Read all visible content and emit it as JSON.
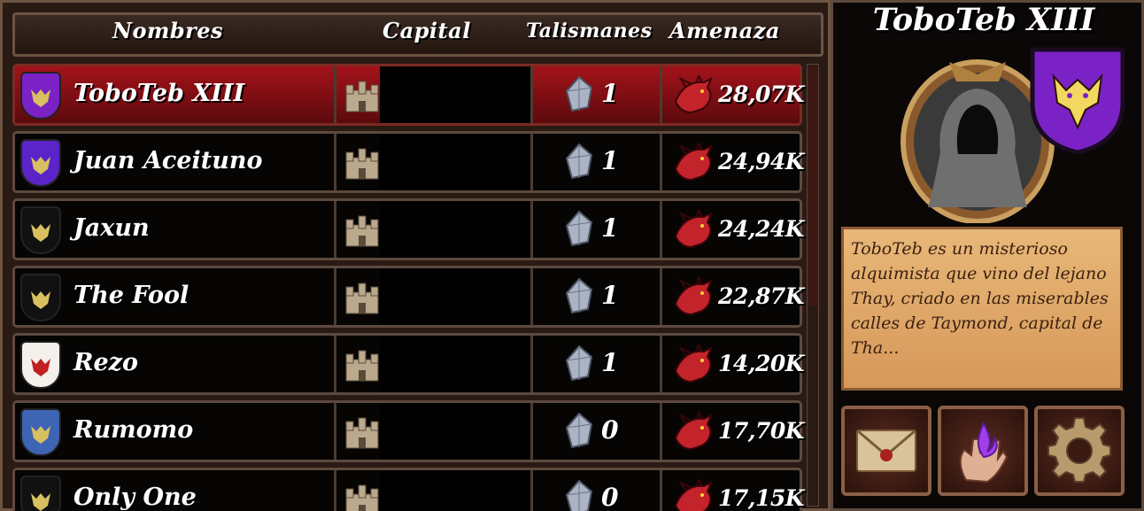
{
  "headers": {
    "names": "Nombres",
    "capital": "Capital",
    "talismans": "Talismanes",
    "threat": "Amenaza"
  },
  "rows": [
    {
      "name": "ToboTeb XIII",
      "talismans": "1",
      "threat": "28,07K",
      "shield_color": "#7a22c6",
      "emblem": "dragon-sigil-icon",
      "selected": true
    },
    {
      "name": "Juan Aceituno",
      "talismans": "1",
      "threat": "24,94K",
      "shield_color": "#5a24c8",
      "emblem": "horse-sigil-icon",
      "selected": false
    },
    {
      "name": "Jaxun",
      "talismans": "1",
      "threat": "24,24K",
      "shield_color": "#111111",
      "emblem": "unicorn-sigil-icon",
      "selected": false
    },
    {
      "name": "The Fool",
      "talismans": "1",
      "threat": "22,87K",
      "shield_color": "#111111",
      "emblem": "moth-sigil-icon",
      "selected": false
    },
    {
      "name": "Rezo",
      "talismans": "1",
      "threat": "14,20K",
      "shield_color": "#f4f0ec",
      "emblem": "knot-sigil-icon",
      "selected": false
    },
    {
      "name": "Rumomo",
      "talismans": "0",
      "threat": "17,70K",
      "shield_color": "#3e64b4",
      "emblem": "flower-sigil-icon",
      "selected": false
    },
    {
      "name": "Only One",
      "talismans": "0",
      "threat": "17,15K",
      "shield_color": "#111111",
      "emblem": "crown-sigil-icon",
      "selected": false
    }
  ],
  "panel": {
    "title": "ToboTeb XIII",
    "description": "ToboTeb es un misterioso alquimista que vino del lejano Thay, criado en las miserables calles de Taymond, capital de Tha..."
  },
  "colors": {
    "selected_row": "#a3131a",
    "parchment": "#e0aa6a",
    "accent_purple": "#7a22c6"
  }
}
